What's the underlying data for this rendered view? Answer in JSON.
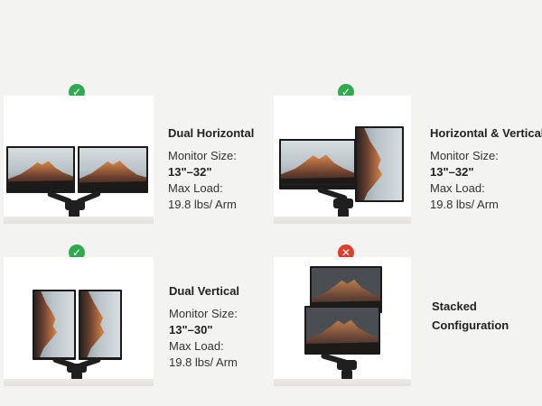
{
  "configs": [
    {
      "title": "Dual Horizontal",
      "monitor_size_label": "Monitor Size:",
      "monitor_size": "13\"–32\"",
      "max_load_label": "Max Load:",
      "max_load": "19.8 lbs/ Arm",
      "status": "supported",
      "status_icon": "check-icon"
    },
    {
      "title": "Horizontal & Vertical",
      "monitor_size_label": "Monitor Size:",
      "monitor_size": "13\"–32\"",
      "max_load_label": "Max Load:",
      "max_load": "19.8 lbs/ Arm",
      "status": "supported",
      "status_icon": "check-icon"
    },
    {
      "title": "Dual Vertical",
      "monitor_size_label": "Monitor Size:",
      "monitor_size": "13\"–30\"",
      "max_load_label": "Max Load:",
      "max_load": "19.8 lbs/ Arm",
      "status": "supported",
      "status_icon": "check-icon"
    },
    {
      "title_line1": "Stacked",
      "title_line2": "Configuration",
      "status": "not-supported",
      "status_icon": "cross-icon"
    }
  ],
  "icons": {
    "check": "✓",
    "cross": "✕"
  },
  "colors": {
    "check": "#33a852",
    "cross": "#d9412f",
    "background": "#f3f3f1"
  }
}
